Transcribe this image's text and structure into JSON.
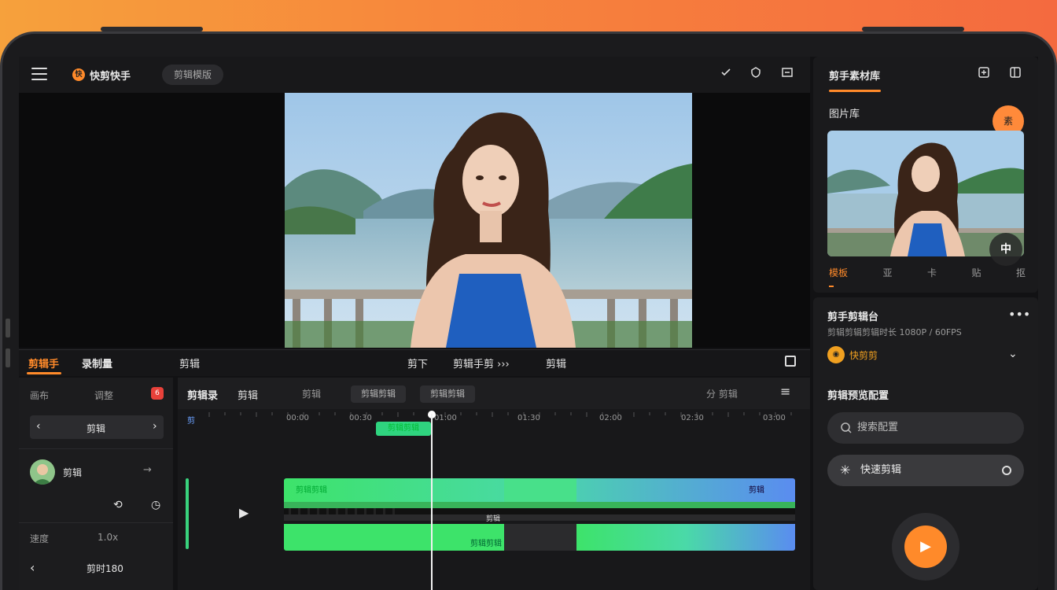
{
  "app": {
    "logo_badge": "快",
    "name": "快剪快手",
    "mode_pill": "剪辑模版"
  },
  "top_icons": [
    "check-icon",
    "shield-icon",
    "export-icon"
  ],
  "right_panel": {
    "title": "剪手素材库",
    "section_label": "图片库",
    "avatar_label": "素",
    "overlay_badge": "中",
    "tools": [
      {
        "label": "模板",
        "active": true
      },
      {
        "label": "亚",
        "active": false
      },
      {
        "label": "卡",
        "active": false
      },
      {
        "label": "贴",
        "active": false
      },
      {
        "label": "抠",
        "active": false
      }
    ]
  },
  "settings_panel": {
    "title": "剪手剪辑台",
    "subtitle": "剪辑剪辑剪辑时长 1080P / 60FPS",
    "dropdown_label": "快剪剪",
    "section_title": "剪辑预览配置",
    "search_placeholder": "搜索配置",
    "toggle_label": "快速剪辑"
  },
  "bottom_tabs": {
    "left": [
      {
        "label": "剪辑手",
        "active": true
      },
      {
        "label": "录制量",
        "active": false
      }
    ],
    "middle_label": "剪辑",
    "center_items": [
      "剪下",
      "剪辑手剪 ›››",
      "剪辑"
    ]
  },
  "left_panel": {
    "row1_left": "画布",
    "row1_mid": "调整",
    "badge_value": "6",
    "segment_label": "剪辑",
    "user_name": "剪辑",
    "row4_left": "速度",
    "row4_mid": "1.0x",
    "row5_label": "剪时180"
  },
  "timeline": {
    "title": "剪辑录",
    "subtitle": "剪辑",
    "sub2": "剪辑",
    "btn1": "剪辑剪辑",
    "btn2": "剪辑剪辑",
    "right_label": "分 剪辑",
    "ruler_first": "剪",
    "ticks": [
      "00:00",
      "00:30",
      "01:00",
      "01:30",
      "02:00",
      "02:30",
      "03:00"
    ],
    "clip_label": "剪辑剪辑",
    "track_label_left": "剪辑剪辑",
    "track_label_right": "剪辑",
    "audio_label": "剪辑剪辑",
    "audio_mid_label": "剪辑"
  },
  "colors": {
    "accent": "#ff8a2a",
    "track_start": "#3de36a",
    "track_end": "#5a8cf0"
  }
}
